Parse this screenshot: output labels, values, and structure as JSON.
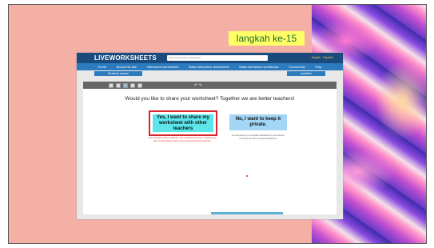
{
  "slide": {
    "tag": "langkah ke-15"
  },
  "header": {
    "logo": "LIVEWORKSHEETS",
    "search_placeholder": "Search interactive worksheets",
    "lang_en": "English",
    "lang_es": "Español"
  },
  "nav": {
    "items": [
      "Home",
      "About this site",
      "Interactive worksheets",
      "Make interactive worksheets",
      "Make interactive workbooks",
      "Community",
      "Help"
    ]
  },
  "subbar": {
    "student_access": "Students access",
    "account": "Indrafitra"
  },
  "content": {
    "question": "Would you like to share your worksheet? Together we are better teachers!",
    "yes_label": "Yes, I want to share my worksheet with other teachers",
    "no_label": "No, I want to keep it private.",
    "yes_note": "Your worksheet will be available in the worksheets directory. Teachers may use it in their classes and it may be shared with other teachers.",
    "no_note": "You can have up to 10 private worksheets in your account. Currently you have 0 private worksheets."
  },
  "colors": {
    "background": "#f5b0a6",
    "highlight": "#ffff66",
    "yes": "#5ce6ea",
    "no": "#a3d6f5",
    "frame": "#d9252b"
  }
}
